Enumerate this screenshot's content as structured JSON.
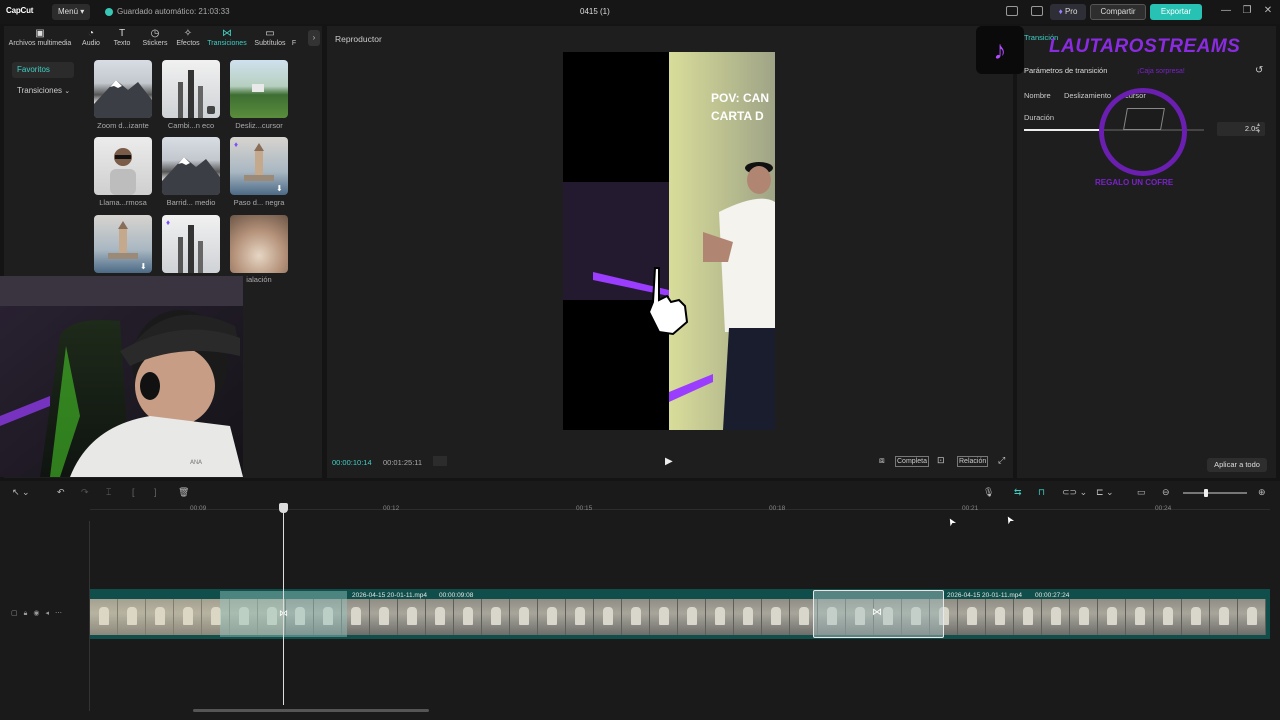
{
  "titlebar": {
    "logo": "CapCut",
    "menu": "Menú",
    "autosave": "Guardado automático: 21:03:33",
    "project": "0415 (1)",
    "pro": "Pro",
    "share": "Compartir",
    "export": "Exportar",
    "minimize": "—",
    "restore": "❐",
    "close": "✕"
  },
  "media_tabs": [
    {
      "label": "Archivos multimedia",
      "icon": "media-icon"
    },
    {
      "label": "Audio",
      "icon": "audio-icon"
    },
    {
      "label": "Texto",
      "icon": "text-icon"
    },
    {
      "label": "Stickers",
      "icon": "sticker-icon"
    },
    {
      "label": "Efectos",
      "icon": "effects-icon"
    },
    {
      "label": "Transiciones",
      "icon": "transition-icon"
    },
    {
      "label": "Subtítulos",
      "icon": "subtitles-icon"
    },
    {
      "label": "F",
      "icon": "filter-icon"
    }
  ],
  "sidebar": {
    "favorites": "Favoritos",
    "transitions": "Transiciones"
  },
  "transitions": [
    {
      "label": "Zoom d...izante"
    },
    {
      "label": "Cambi...n eco"
    },
    {
      "label": "Desliz...cursor"
    },
    {
      "label": "Llama...rmosa"
    },
    {
      "label": "Barrid... medio"
    },
    {
      "label": "Paso d... negra"
    },
    {
      "label": ""
    },
    {
      "label": ""
    },
    {
      "label": "ialación"
    }
  ],
  "player": {
    "title": "Reproductor",
    "current_time": "00:00:10:14",
    "total_time": "00:01:25:11",
    "full_btn": "Completa",
    "ratio_btn": "Relación",
    "video_text_line1": "POV: CAN",
    "video_text_line2": "CARTA D"
  },
  "right_panel": {
    "section": "Transición",
    "params": "Parámetros de transición",
    "name_label": "Nombre",
    "name_value": "Deslizamiento",
    "name_value2": "cursor",
    "duration_label": "Duración",
    "duration_value": "2.0s",
    "apply_all": "Aplicar a todo",
    "overlay_brand": "LAUTAROSTREAMS",
    "overlay_sub": "REGALO UN COFRE",
    "overlay_tag": "¡Caja sorpresa!"
  },
  "timeline": {
    "ruler": [
      "00:09",
      "00:12",
      "00:15",
      "00:18",
      "00:21",
      "00:24"
    ],
    "clip1_name": "2026-04-15 20-01-11.mp4",
    "clip1_dur": "00:00:09:08",
    "clip2_name": "2026-04-15 20-01-11.mp4",
    "clip2_dur": "00:00:27:24"
  },
  "colors": {
    "accent": "#28c2b5",
    "track": "#0f4e4a",
    "purple": "#7a22c9"
  }
}
